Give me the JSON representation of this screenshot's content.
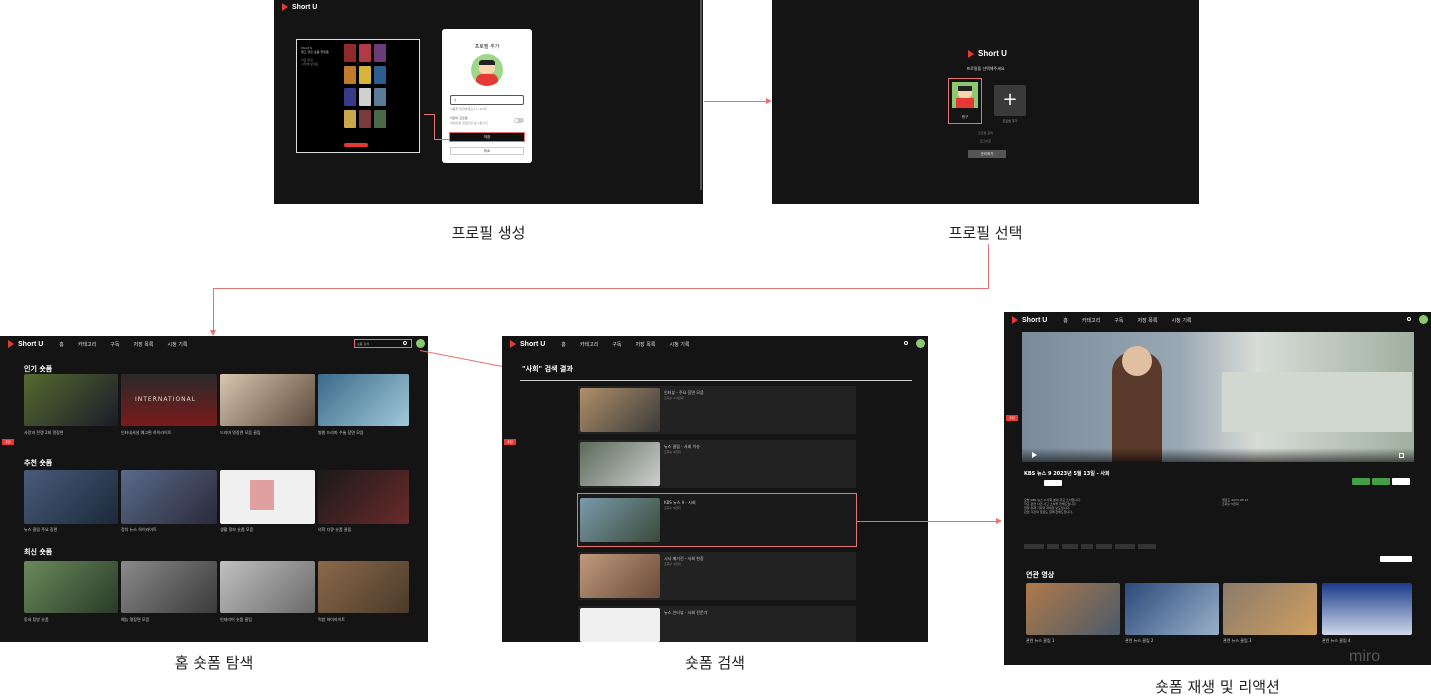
{
  "brand": {
    "name": "Short U"
  },
  "captions": {
    "profile_create": "프로필 생성",
    "profile_select": "프로필 선택",
    "home": "홈 숏폼 탐색",
    "search": "숏폼 검색",
    "play": "숏폼 재생 및 리액션"
  },
  "nav": [
    "홈",
    "카테고리",
    "구독",
    "저장 목록",
    "시청 기록"
  ],
  "profile_create": {
    "dialog_title": "프로필 추가",
    "input_value": "ㄱ",
    "child_label": "어린이 프로필",
    "save_button": "저장",
    "cancel_button": "취소"
  },
  "profile_select": {
    "prompt": "프로필을 선택해주세요",
    "profile_name": "짱구",
    "add_label": "프로필 추가",
    "manage_button": "관리하기"
  },
  "home": {
    "sections": [
      "인기 숏폼",
      "추천 숏폼",
      "최신 숏폼"
    ],
    "search_placeholder": "숏폼 검색"
  },
  "search": {
    "heading": "\"사회\" 검색 결과"
  },
  "play": {
    "video_title": "KBS 뉴스 9 2023년 5월 13일 - 사회",
    "related_heading": "연관 영상",
    "watermark": "miro"
  },
  "colors": {
    "accent": "#e53935",
    "bg": "#141414",
    "link": "#e57373",
    "like": "#43a047"
  }
}
